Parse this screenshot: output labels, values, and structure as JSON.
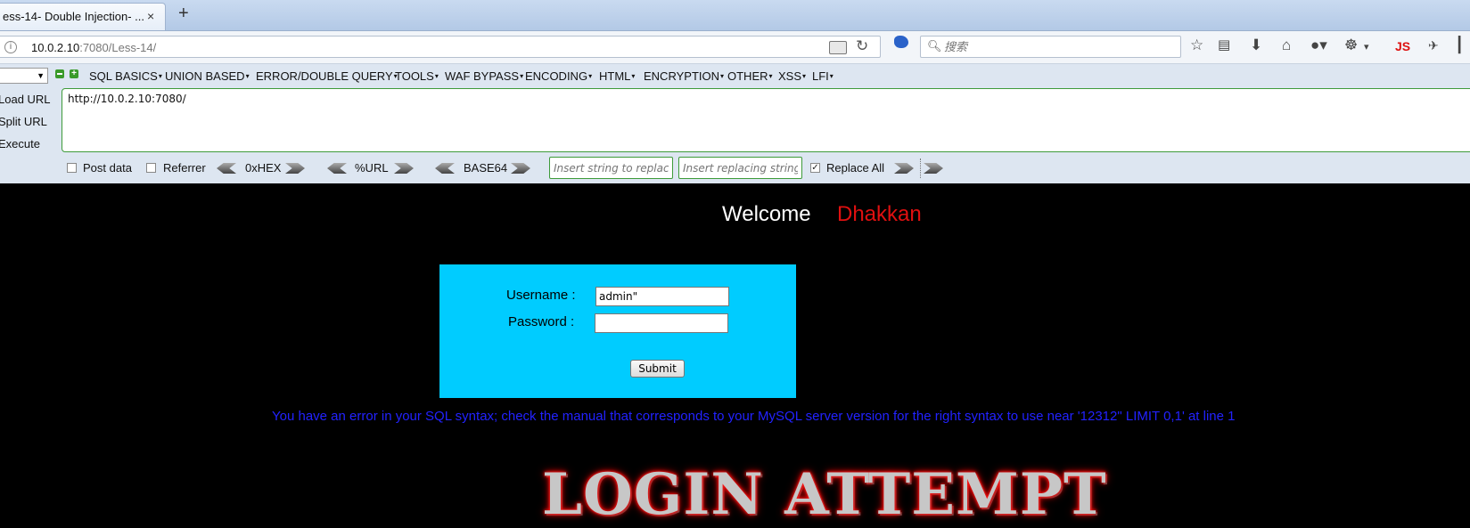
{
  "browser": {
    "tab_title": "ess-14- Double Injection- ...",
    "tab_close": "×",
    "new_tab": "+",
    "url_host": "10.0.2.10",
    "url_rest": ":7080/Less-14/",
    "search_placeholder": "搜索",
    "js_label": "JS"
  },
  "hackbar": {
    "menus": [
      "SQL BASICS",
      "UNION BASED",
      "ERROR/DOUBLE QUERY",
      "TOOLS",
      "WAF BYPASS",
      "ENCODING",
      "HTML",
      "ENCRYPTION",
      "OTHER",
      "XSS",
      "LFI"
    ],
    "load_url": "Load URL",
    "split_url": "Split URL",
    "execute": "Execute",
    "url_value": "http://10.0.2.10:7080/",
    "post_data": "Post data",
    "referrer": "Referrer",
    "hex": "0xHEX",
    "url_enc": "%URL",
    "base64": "BASE64",
    "replace_placeholder": "Insert string to replace",
    "replacing_placeholder": "Insert replacing string",
    "replace_all": "Replace All",
    "post_data_checked": false,
    "referrer_checked": false,
    "replace_all_checked": true
  },
  "page": {
    "welcome": "Welcome",
    "name": "Dhakkan",
    "username_label": "Username :",
    "password_label": "Password :",
    "username_value": "admin\"",
    "password_value": "",
    "submit": "Submit",
    "error": "You have an error in your SQL syntax; check the manual that corresponds to your MySQL server version for the right syntax to use near '12312\" LIMIT 0,1' at line 1",
    "banner": "LOGIN ATTEMPT"
  }
}
